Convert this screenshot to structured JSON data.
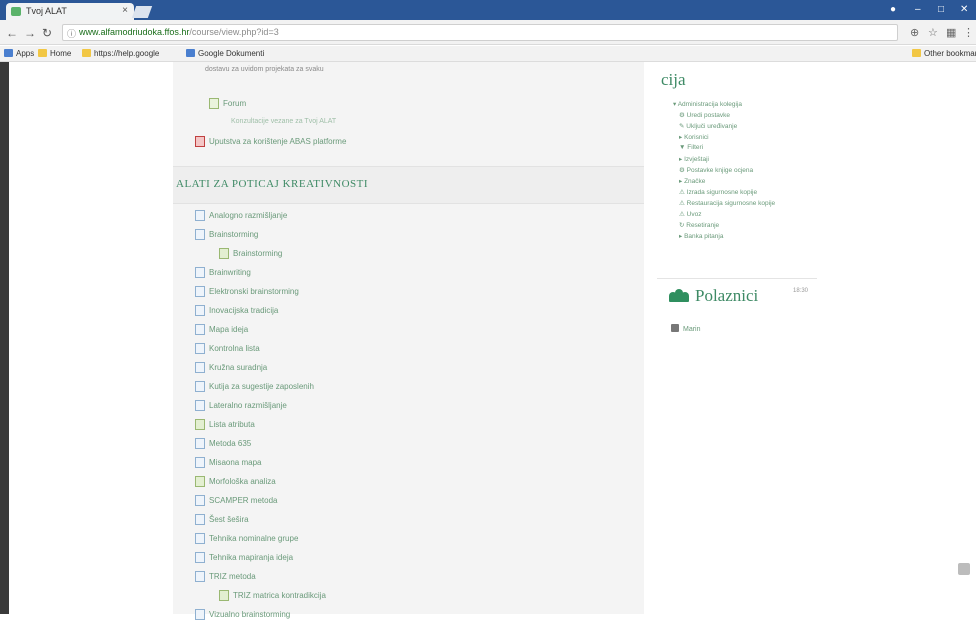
{
  "browser": {
    "tab_title": "Tvoj ALAT",
    "tab_close": "×",
    "url_highlight": "www.alfamodriudoka.ffos.hr",
    "url_rest": "/course/view.php?id=3",
    "bookmarks": [
      {
        "label": "Apps",
        "color": "#4a7fcf"
      },
      {
        "label": "Home",
        "color": "#f2c744"
      },
      {
        "label": "https://help.google",
        "color": "#f2c744"
      },
      {
        "label": "Google Dokumenti",
        "color": "#4a7fcf"
      }
    ],
    "other_bookmarks": "Other bookmarks"
  },
  "course": {
    "intro": "dostavu za uvidom projekata za svaku",
    "top_items": [
      {
        "label": "Forum",
        "icon": "forum"
      },
      {
        "label": "Konzultacije vezane za Tvoj ALAT",
        "icon": "none"
      },
      {
        "label": "Uputstva za korištenje ABAS platforme",
        "icon": "pdf"
      }
    ],
    "section_title": "ALATI ZA POTICAJ KREATIVNOSTI",
    "items": [
      {
        "label": "Analogno razmišljanje",
        "icon": "page"
      },
      {
        "label": "Brainstorming",
        "icon": "page"
      },
      {
        "label": "Brainstorming",
        "icon": "tool",
        "indent": true
      },
      {
        "label": "Brainwriting",
        "icon": "page"
      },
      {
        "label": "Elektronski brainstorming",
        "icon": "page"
      },
      {
        "label": "Inovacijska tradicija",
        "icon": "page"
      },
      {
        "label": "Mapa ideja",
        "icon": "page"
      },
      {
        "label": "Kontrolna lista",
        "icon": "page"
      },
      {
        "label": "Kružna suradnja",
        "icon": "page"
      },
      {
        "label": "Kutija za sugestije zaposlenih",
        "icon": "page"
      },
      {
        "label": "Lateralno razmišljanje",
        "icon": "page"
      },
      {
        "label": "Lista atributa",
        "icon": "tool"
      },
      {
        "label": "Metoda 635",
        "icon": "page"
      },
      {
        "label": "Misaona mapa",
        "icon": "page"
      },
      {
        "label": "Morfološka analiza",
        "icon": "tool"
      },
      {
        "label": "SCAMPER metoda",
        "icon": "page"
      },
      {
        "label": "Šest šešira",
        "icon": "page"
      },
      {
        "label": "Tehnika nominalne grupe",
        "icon": "page"
      },
      {
        "label": "Tehnika mapiranja ideja",
        "icon": "page"
      },
      {
        "label": "TRIZ metoda",
        "icon": "page"
      },
      {
        "label": "TRIZ matrica kontradikcija",
        "icon": "tool",
        "indent": true
      },
      {
        "label": "Vizualno brainstorming",
        "icon": "page"
      }
    ]
  },
  "sidebar": {
    "heading": "cija",
    "tree": [
      {
        "label": "▾ Administracija kolegija",
        "indent": 0
      },
      {
        "label": "⚙ Uredi postavke",
        "indent": 1
      },
      {
        "label": "✎ Uključi uređivanje",
        "indent": 1
      },
      {
        "label": "▸ Korisnici",
        "indent": 1
      },
      {
        "label": "▼ Filteri",
        "indent": 1
      },
      {
        "label": "▸ Izvještaji",
        "indent": 1
      },
      {
        "label": "⚙ Postavke knjige ocjena",
        "indent": 1
      },
      {
        "label": "▸ Značke",
        "indent": 1
      },
      {
        "label": "⚠ Izrada sigurnosne kopije",
        "indent": 1
      },
      {
        "label": "⚠ Restauracija sigurnosne kopije",
        "indent": 1
      },
      {
        "label": "⚠ Uvoz",
        "indent": 1
      },
      {
        "label": "↻ Resetiranje",
        "indent": 1
      },
      {
        "label": "▸ Banka pitanja",
        "indent": 1
      }
    ],
    "participants_title": "Polaznici",
    "participants_count": "18:30",
    "participant_user": "Marin"
  }
}
